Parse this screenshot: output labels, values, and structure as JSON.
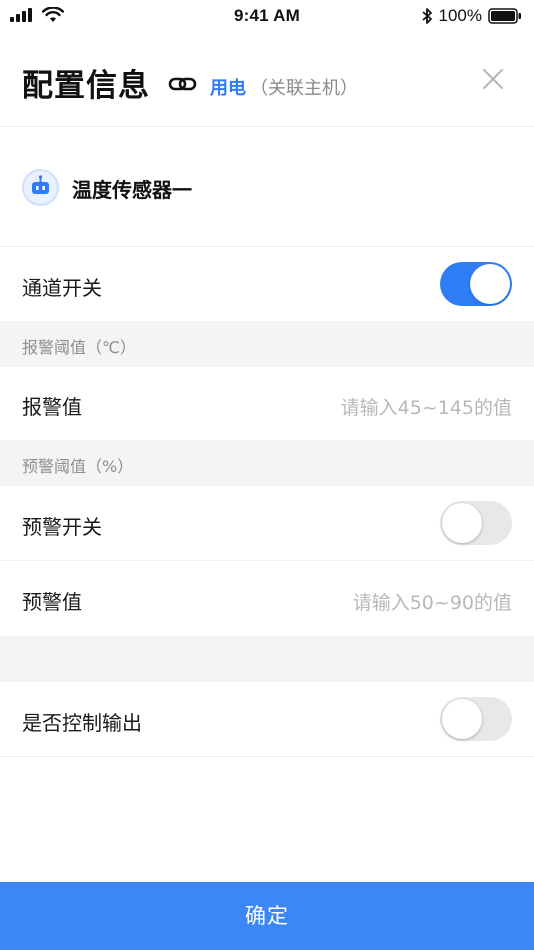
{
  "status_bar": {
    "time": "9:41 AM",
    "battery": "100%",
    "signal_icon": "signal-bars-icon",
    "wifi_icon": "wifi-icon",
    "bluetooth_icon": "bluetooth-icon",
    "battery_icon": "battery-icon"
  },
  "header": {
    "title": "配置信息",
    "link_icon": "link-icon",
    "power_label": "用电",
    "host_label": "（关联主机）",
    "close_icon": "close-icon",
    "accent_color": "#2f7df5"
  },
  "sensor": {
    "name": "温度传感器一",
    "icon": "sensor-device-icon"
  },
  "channel_switch": {
    "label": "通道开关",
    "on": true
  },
  "alarm_section": {
    "title": "报警阈值（℃）",
    "value_label": "报警值",
    "value_placeholder": "请输入45~145的值"
  },
  "warning_section": {
    "title": "预警阈值（%）",
    "switch_label": "预警开关",
    "switch_on": false,
    "value_label": "预警值",
    "value_placeholder": "请输入50~90的值"
  },
  "control_output": {
    "label": "是否控制输出",
    "on": false
  },
  "confirm_button": {
    "label": "确定",
    "color": "#3d86f6"
  }
}
